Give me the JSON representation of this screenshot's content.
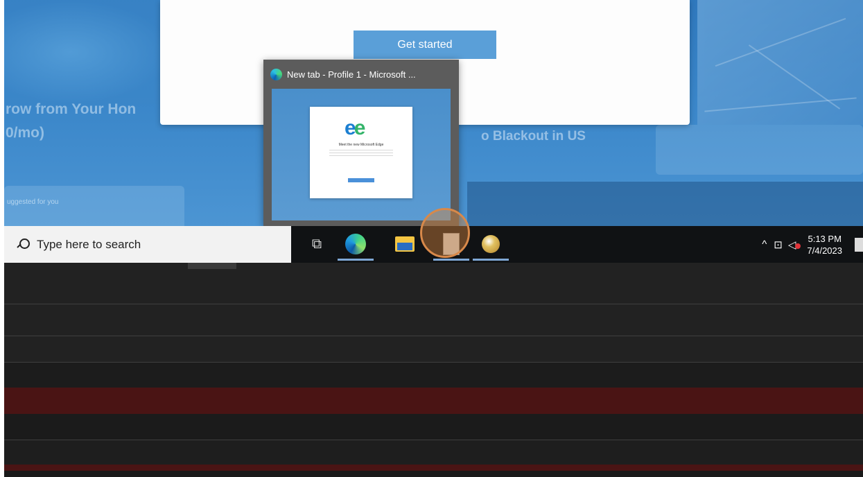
{
  "dialog": {
    "get_started_label": "Get started"
  },
  "preview": {
    "title": "New tab - Profile 1 - Microsoft ...",
    "thumbnail_heading": "Meet the new Microsoft Edge"
  },
  "background": {
    "headline_left": "row from Your Hon",
    "headline_left_2": "0/mo)",
    "headline_right": "o Blackout in US",
    "card_left_text": "uggested for you"
  },
  "taskbar": {
    "search_placeholder": "Type here to search",
    "clock_time": "5:13 PM",
    "clock_date": "7/4/2023",
    "icons": [
      "task-view-icon",
      "edge-icon",
      "file-explorer-icon",
      "app-icon",
      "user-app-icon"
    ],
    "accent_color": "#7fa8d6"
  },
  "colors": {
    "taskbar_bg": "#101214",
    "dark_area": "#222222",
    "maroon_row": "#4a1414",
    "button_blue": "#5a9fd8"
  }
}
